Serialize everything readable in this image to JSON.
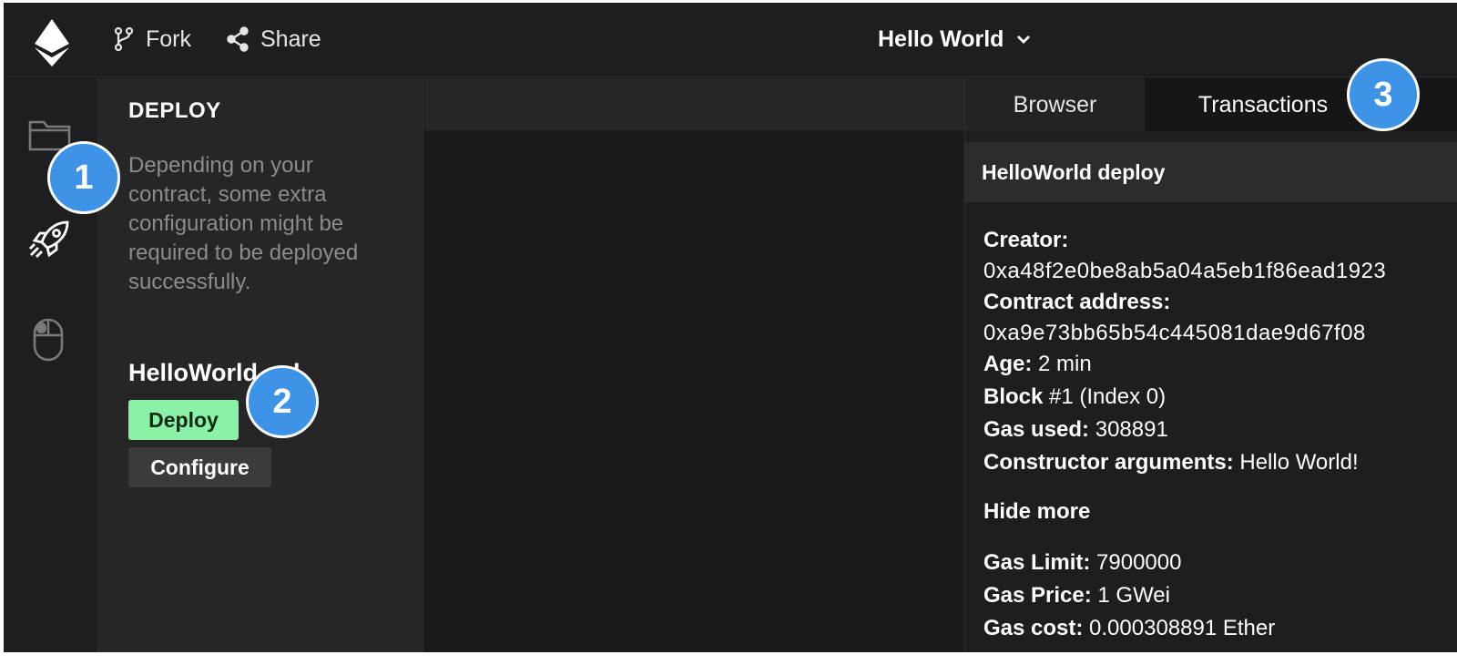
{
  "topbar": {
    "fork_label": "Fork",
    "share_label": "Share",
    "project_title": "Hello World"
  },
  "icons": {
    "logo": "ethereum-logo",
    "fork": "git-fork-icon",
    "share": "share-icon",
    "project_dropdown": "chevron-down-icon",
    "files": "folder-icon",
    "deploy": "rocket-icon",
    "interact": "mouse-icon"
  },
  "panel": {
    "title": "DEPLOY",
    "description": "Depending on your contract, some extra configuration might be required to be deployed successfully.",
    "contract_name": "HelloWorld.sol",
    "deploy_label": "Deploy",
    "configure_label": "Configure"
  },
  "right_panel": {
    "tabs": [
      {
        "label": "Browser"
      },
      {
        "label": "Transactions"
      }
    ],
    "tx_title": "HelloWorld deploy",
    "details": {
      "creator_label": "Creator:",
      "creator_value": "0xa48f2e0be8ab5a04a5eb1f86ead1923",
      "contract_address_label": "Contract address:",
      "contract_address_value": "0xa9e73bb65b54c445081dae9d67f08",
      "age_label": "Age:",
      "age_value": " 2 min",
      "block_label": "Block",
      "block_value": " #1 (Index 0)",
      "gas_used_label": "Gas used:",
      "gas_used_value": " 308891",
      "constructor_label": "Constructor arguments:",
      "constructor_value": " Hello World!",
      "hide_more": "Hide more",
      "gas_limit_label": "Gas Limit:",
      "gas_limit_value": " 7900000",
      "gas_price_label": "Gas Price:",
      "gas_price_value": " 1 GWei",
      "gas_cost_label": "Gas cost:",
      "gas_cost_value": " 0.000308891 Ether"
    }
  },
  "callouts": [
    {
      "number": "1"
    },
    {
      "number": "2"
    },
    {
      "number": "3"
    }
  ],
  "colors": {
    "background": "#1a1a1b",
    "deploy_button": "#8af2a7",
    "callout": "#3c93e8"
  }
}
